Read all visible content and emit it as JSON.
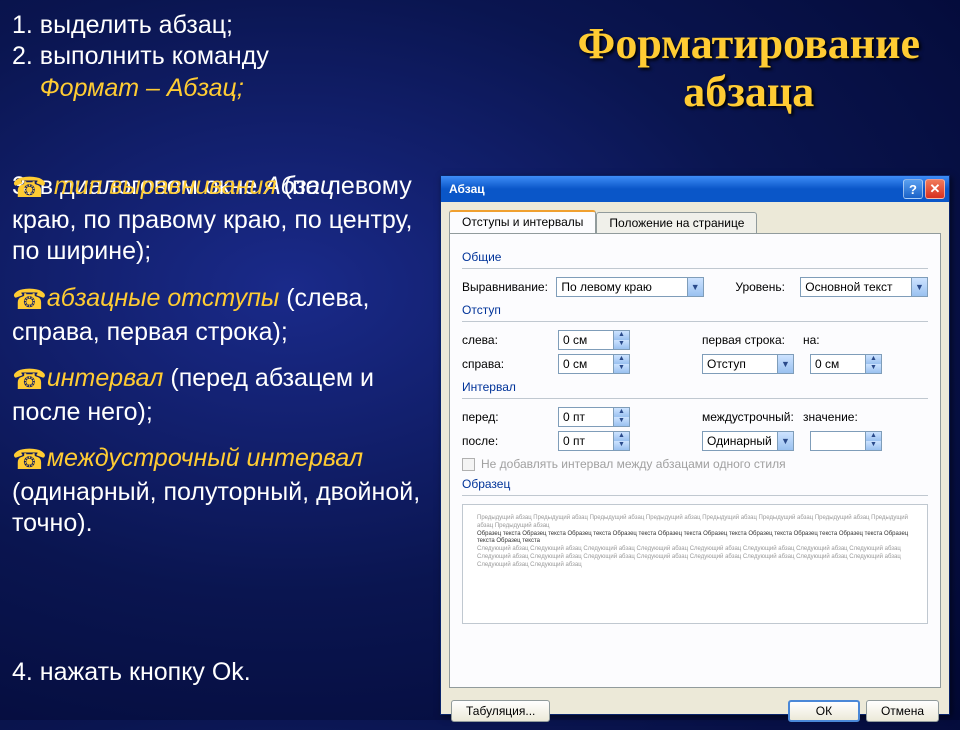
{
  "title_line1": "Форматирование",
  "title_line2": "абзаца",
  "steps": {
    "s1": "1. выделить абзац;",
    "s2": "2. выполнить команду",
    "s2_cmd": "Формат – Абзац;",
    "s3a": "3. в диалоговом окне ",
    "s3b": "Абзац",
    "s4": "4. нажать кнопку Ok."
  },
  "bullets": {
    "b1_hl": "тип выравнивания",
    "b1_txt": " (по левому краю, по правому краю, по центру, по ширине);",
    "b2_hl": "абзацные отступы",
    "b2_txt": " (слева, справа, первая строка);",
    "b3_hl": "интервал",
    "b3_txt": " (перед абзацем и после него);",
    "b4_hl": "междустрочный интервал",
    "b4_txt": " (одинарный, полуторный, двойной, точно)."
  },
  "icons": {
    "tel": "☎"
  },
  "dialog": {
    "title": "Абзац",
    "help": "?",
    "close": "✕",
    "tab1": "Отступы и интервалы",
    "tab2": "Положение на странице",
    "groups": {
      "general": "Общие",
      "indent": "Отступ",
      "spacing": "Интервал",
      "preview": "Образец"
    },
    "labels": {
      "align": "Выравнивание:",
      "level": "Уровень:",
      "left": "слева:",
      "right": "справа:",
      "firstline": "первая строка:",
      "by": "на:",
      "before": "перед:",
      "after": "после:",
      "linespacing": "междустрочный:",
      "value": "значение:"
    },
    "values": {
      "align": "По левому краю",
      "level": "Основной текст",
      "left": "0 см",
      "right": "0 см",
      "firstline": "Отступ",
      "by": "0 см",
      "before": "0 пт",
      "after": "0 пт",
      "linespacing": "Одинарный",
      "value": ""
    },
    "checkbox": "Не добавлять интервал между абзацами одного стиля",
    "preview_gray": "Предыдущий абзац Предыдущий абзац Предыдущий абзац Предыдущий абзац Предыдущий абзац Предыдущий абзац Предыдущий абзац Предыдущий абзац Предыдущий абзац",
    "preview_dark": "Образец текста Образец текста Образец текста Образец текста Образец текста Образец текста Образец текста Образец текста Образец текста Образец текста Образец текста",
    "preview_tail": "Следующий абзац Следующий абзац Следующий абзац Следующий абзац Следующий абзац Следующий абзац Следующий абзац Следующий абзац Следующий абзац Следующий абзац Следующий абзац Следующий абзац Следующий абзац Следующий абзац Следующий абзац Следующий абзац Следующий абзац Следующий абзац",
    "buttons": {
      "tabs": "Табуляция...",
      "ok": "ОК",
      "cancel": "Отмена"
    }
  }
}
